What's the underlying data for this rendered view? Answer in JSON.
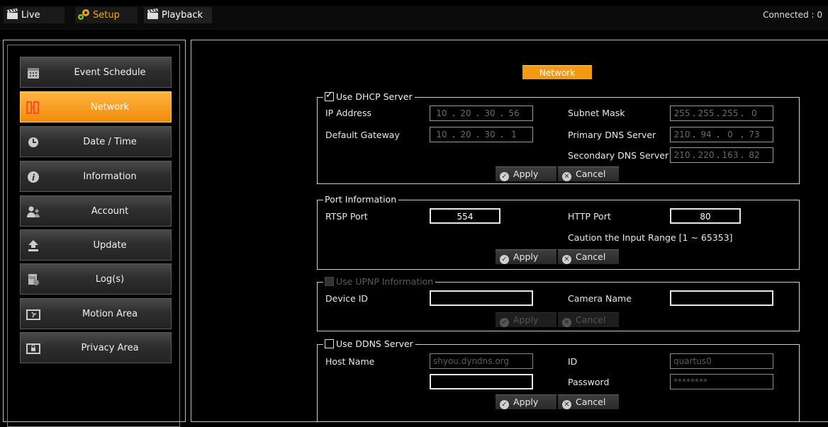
{
  "topbar": {
    "tabs": [
      {
        "label": "Live",
        "icon": "clapper-icon"
      },
      {
        "label": "Setup",
        "icon": "gears-icon"
      },
      {
        "label": "Playback",
        "icon": "clapper-icon"
      }
    ],
    "status": "Connected : 0"
  },
  "sidebar": {
    "items": [
      {
        "label": "Event Schedule",
        "icon": "calendar-icon"
      },
      {
        "label": "Network",
        "icon": "network-icon",
        "active": true
      },
      {
        "label": "Date / Time",
        "icon": "clock-icon"
      },
      {
        "label": "Information",
        "icon": "info-icon"
      },
      {
        "label": "Account",
        "icon": "users-icon"
      },
      {
        "label": "Update",
        "icon": "upload-icon"
      },
      {
        "label": "Log(s)",
        "icon": "log-icon"
      },
      {
        "label": "Motion Area",
        "icon": "motion-icon"
      },
      {
        "label": "Privacy Area",
        "icon": "lock-icon"
      }
    ]
  },
  "page": {
    "title": "Network"
  },
  "dhcp": {
    "legend": "Use DHCP Server",
    "checked": true,
    "ip_label": "IP Address",
    "ip": [
      "10",
      "20",
      "30",
      "56"
    ],
    "subnet_label": "Subnet Mask",
    "subnet": [
      "255",
      "255",
      "255",
      "0"
    ],
    "gateway_label": "Default Gateway",
    "gateway": [
      "10",
      "20",
      "30",
      "1"
    ],
    "dns1_label": "Primary DNS Server",
    "dns1": [
      "210",
      "94",
      "0",
      "73"
    ],
    "dns2_label": "Secondary DNS Server",
    "dns2": [
      "210",
      "220",
      "163",
      "82"
    ],
    "apply": "Apply",
    "cancel": "Cancel"
  },
  "port": {
    "legend": "Port Information",
    "rtsp_label": "RTSP Port",
    "rtsp_value": "554",
    "http_label": "HTTP Port",
    "http_value": "80",
    "caution": "Caution the Input Range  [1 ~ 65353]",
    "apply": "Apply",
    "cancel": "Cancel"
  },
  "upnp": {
    "legend": "Use UPNP Information",
    "enabled": false,
    "device_label": "Device ID",
    "device_value": "",
    "camera_label": "Camera Name",
    "camera_value": "",
    "apply": "Apply",
    "cancel": "Cancel"
  },
  "ddns": {
    "legend": "Use DDNS Server",
    "checked": false,
    "host_label": "Host Name",
    "host_value": "shyou.dyndns.org",
    "host2_value": "",
    "id_label": "ID",
    "id_value": "quartus0",
    "password_label": "Password",
    "password_value": "********",
    "apply": "Apply",
    "cancel": "Cancel"
  }
}
